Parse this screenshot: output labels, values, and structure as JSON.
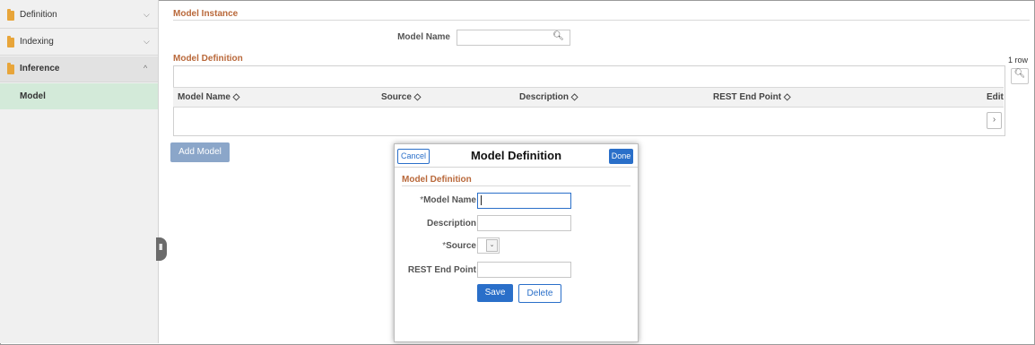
{
  "sidebar": {
    "items": [
      {
        "label": "Definition",
        "chevron": "⌵",
        "icon": "folder-icon"
      },
      {
        "label": "Indexing",
        "chevron": "⌵",
        "icon": "folder-icon"
      },
      {
        "label": "Inference",
        "chevron": "^",
        "icon": "folder-icon"
      }
    ],
    "sub_item": "Model",
    "collapse_handle": "II"
  },
  "main": {
    "instance_title": "Model Instance",
    "model_name_label": "Model Name",
    "definition_title": "Model Definition",
    "row_count": "1 row",
    "columns": [
      "Model Name ◇",
      "Source ◇",
      "Description ◇",
      "REST End Point ◇",
      "Edit"
    ],
    "add_button": "Add Model"
  },
  "modal": {
    "cancel": "Cancel",
    "title": "Model Definition",
    "done": "Done",
    "section": "Model Definition",
    "fields": {
      "model_name": {
        "label": "Model Name",
        "required": "*",
        "value": ""
      },
      "description": {
        "label": "Description",
        "value": ""
      },
      "source": {
        "label": "Source",
        "required": "*",
        "value": ""
      },
      "rest": {
        "label": "REST End Point",
        "value": ""
      }
    },
    "save": "Save",
    "delete": "Delete"
  },
  "colors": {
    "accent_blue": "#2a6fc9",
    "section_title": "#b9683a",
    "selected_nav": "#d3ead9",
    "folder": "#e8a53a"
  }
}
